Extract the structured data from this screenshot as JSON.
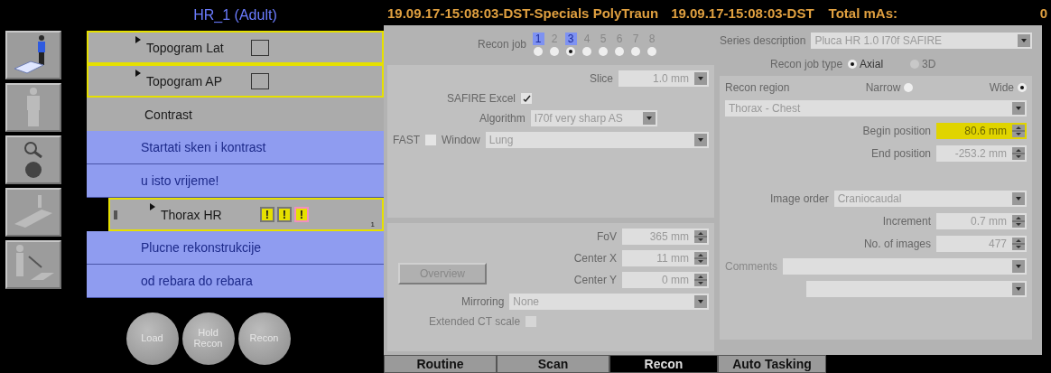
{
  "protocol": {
    "title": "HR_1 (Adult)",
    "steps": [
      {
        "kind": "scan",
        "label": "Topogram Lat",
        "selected": false,
        "checked": false
      },
      {
        "kind": "scan",
        "label": "Topogram AP",
        "selected": false,
        "checked": false
      },
      {
        "kind": "pause",
        "label": "Contrast"
      },
      {
        "kind": "note",
        "label": "Startati sken i kontrast"
      },
      {
        "kind": "note",
        "label": "u isto vrijeme!"
      },
      {
        "kind": "scan",
        "label": "Thorax HR",
        "selected": true,
        "warnings": [
          {
            "text": "!",
            "urgent": false
          },
          {
            "text": "!",
            "urgent": false
          },
          {
            "text": "!",
            "urgent": true
          }
        ],
        "count": "1"
      },
      {
        "kind": "note",
        "label": "Plucne rekonstrukcije"
      },
      {
        "kind": "note",
        "label": "od rebara do rebara"
      }
    ],
    "buttons": [
      "Load",
      "Hold Recon",
      "Recon"
    ]
  },
  "header": {
    "title": "19.09.17-15:08:03-DST-Specials PolyTraun",
    "series": "19.09.17-15:08:03-DST",
    "mas_label": "Total mAs:",
    "mas_value": "0"
  },
  "recon": {
    "job_label": "Recon job",
    "jobs": [
      {
        "label": "1",
        "selected": false,
        "defined": true
      },
      {
        "label": "2",
        "selected": false,
        "defined": false
      },
      {
        "label": "3",
        "selected": true,
        "defined": true
      },
      {
        "label": "4",
        "selected": false,
        "defined": false
      },
      {
        "label": "5",
        "selected": false,
        "defined": false
      },
      {
        "label": "6",
        "selected": false,
        "defined": false
      },
      {
        "label": "7",
        "selected": false,
        "defined": false
      },
      {
        "label": "8",
        "selected": false,
        "defined": false
      }
    ],
    "slice": {
      "label": "Slice",
      "value": "1.0 mm"
    },
    "safire": {
      "label": "SAFIRE Excel",
      "checked": true
    },
    "algorithm": {
      "label": "Algorithm",
      "value": "I70f very sharp AS"
    },
    "fast": {
      "label": "FAST",
      "checked": false
    },
    "window": {
      "label": "Window",
      "value": "Lung"
    },
    "fov": {
      "label": "FoV",
      "value": "365 mm"
    },
    "center_x": {
      "label": "Center X",
      "value": "11 mm"
    },
    "center_y": {
      "label": "Center Y",
      "value": "0 mm"
    },
    "overview_button": "Overview",
    "mirroring": {
      "label": "Mirroring",
      "value": "None"
    },
    "extended_ct": {
      "label": "Extended CT scale",
      "checked": false
    },
    "series_description": {
      "label": "Series description",
      "value": "Pluca HR 1.0  I70f SAFIRE"
    },
    "job_type": {
      "label": "Recon job type",
      "options": [
        {
          "label": "Axial",
          "selected": true,
          "disabled": false
        },
        {
          "label": "3D",
          "selected": false,
          "disabled": true
        }
      ]
    },
    "region": {
      "label": "Recon region",
      "options": [
        {
          "label": "Narrow",
          "selected": false
        },
        {
          "label": "Wide",
          "selected": true
        }
      ],
      "value": "Thorax - Chest"
    },
    "begin": {
      "label": "Begin position",
      "value": "80.6 mm",
      "highlighted": true
    },
    "end": {
      "label": "End position",
      "value": "-253.2 mm",
      "highlighted": false
    },
    "image_order": {
      "label": "Image order",
      "value": "Craniocaudal"
    },
    "increment": {
      "label": "Increment",
      "value": "0.7 mm"
    },
    "images": {
      "label": "No. of images",
      "value": "477"
    },
    "comments": {
      "label": "Comments"
    }
  },
  "tabs": [
    {
      "label": "Routine",
      "selected": false
    },
    {
      "label": "Scan",
      "selected": false
    },
    {
      "label": "Recon",
      "selected": true
    },
    {
      "label": "Auto Tasking",
      "selected": false
    }
  ]
}
